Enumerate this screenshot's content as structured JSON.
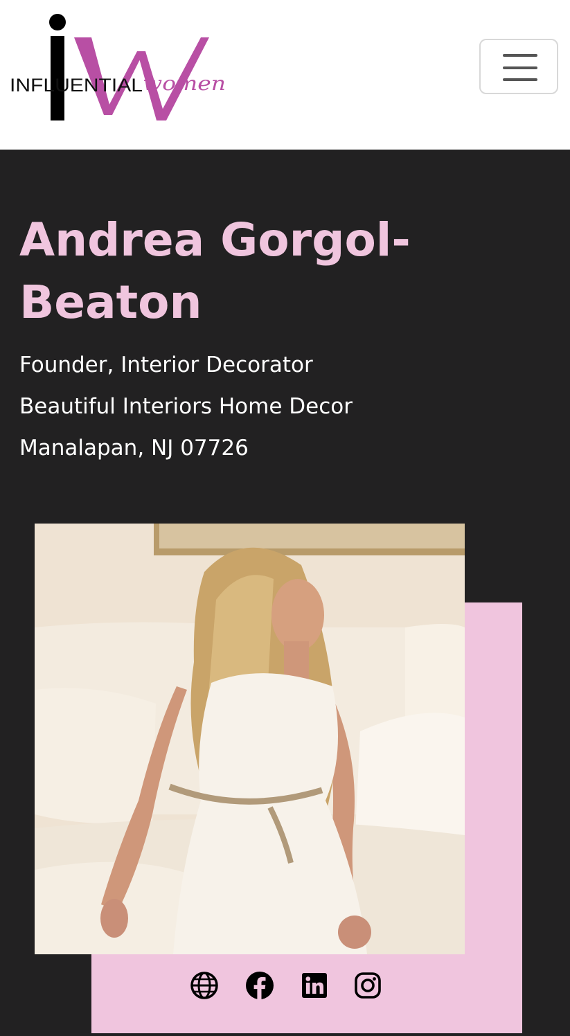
{
  "header": {
    "logo_text": "INFLUENTIAL",
    "logo_script": "women",
    "menu_icon": "hamburger-menu-icon"
  },
  "profile": {
    "name": "Andrea Gorgol-Beaton",
    "title": "Founder, Interior Decorator",
    "company": "Beautiful Interiors Home Decor",
    "location": "Manalapan, NJ 07726",
    "photo_subject": "woman-seated-on-sofa-photo"
  },
  "social_links": [
    {
      "icon": "globe-icon"
    },
    {
      "icon": "facebook-icon"
    },
    {
      "icon": "linkedin-icon"
    },
    {
      "icon": "instagram-icon"
    }
  ],
  "colors": {
    "accent_pink": "#f0c5de",
    "logo_magenta": "#b84fa4",
    "background_dark": "#222122",
    "header_bg": "#ffffff"
  }
}
